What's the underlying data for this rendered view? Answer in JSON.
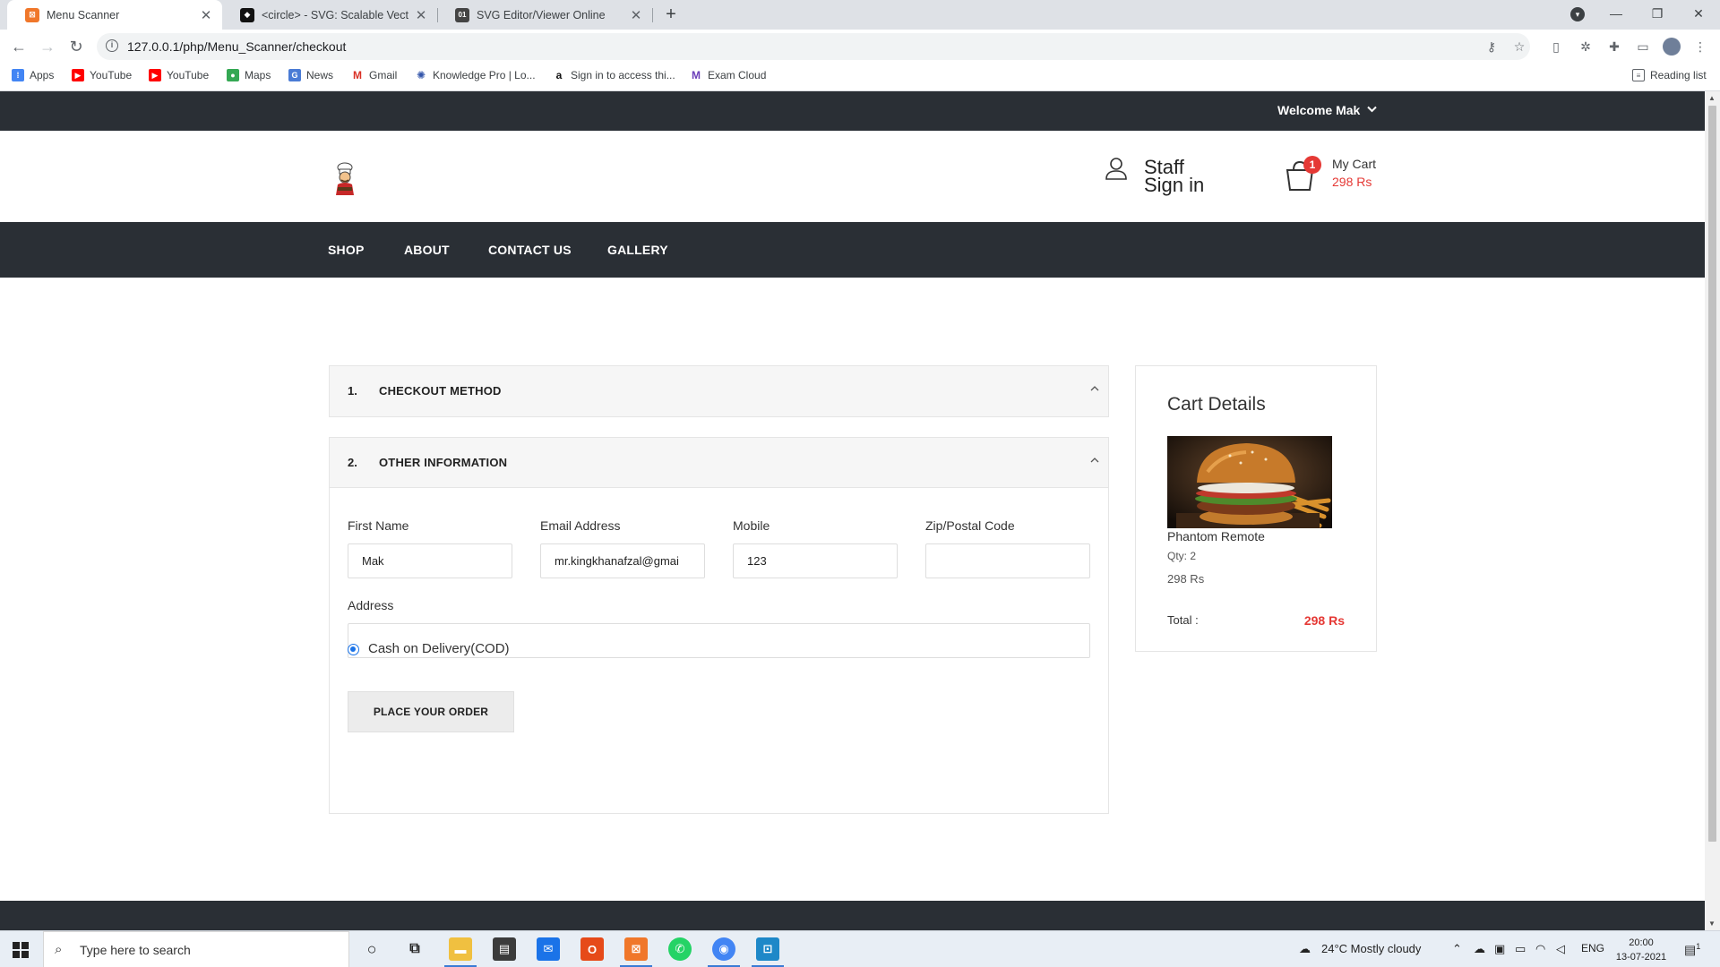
{
  "browser": {
    "tabs": [
      {
        "title": "Menu Scanner",
        "active": true
      },
      {
        "title": "<circle> - SVG: Scalable Vector G",
        "active": false
      },
      {
        "title": "SVG Editor/Viewer Online",
        "active": false
      }
    ],
    "url": "127.0.0.1/php/Menu_Scanner/checkout",
    "bookmarks": [
      "Apps",
      "YouTube",
      "YouTube",
      "Maps",
      "News",
      "Gmail",
      "Knowledge Pro | Lo...",
      "Sign in to access thi...",
      "Exam Cloud"
    ],
    "reading_list": "Reading list"
  },
  "site": {
    "welcome": "Welcome Mak",
    "staff_line1": "Staff",
    "staff_line2": "Sign in",
    "cart_count": "1",
    "cart_label": "My Cart",
    "cart_amount": "298 Rs",
    "nav": [
      "SHOP",
      "ABOUT",
      "CONTACT US",
      "GALLERY"
    ]
  },
  "checkout": {
    "step1": {
      "num": "1.",
      "label": "CHECKOUT METHOD"
    },
    "step2": {
      "num": "2.",
      "label": "OTHER INFORMATION"
    },
    "fields": {
      "first_name": {
        "label": "First Name",
        "value": "Mak"
      },
      "email": {
        "label": "Email Address",
        "value": "mr.kingkhanafzal@gmai"
      },
      "mobile": {
        "label": "Mobile",
        "value": "123"
      },
      "zip": {
        "label": "Zip/Postal Code",
        "value": ""
      },
      "address": {
        "label": "Address",
        "value": ""
      }
    },
    "payment_option": "Cash on Delivery(COD)",
    "place_order": "PLACE YOUR ORDER"
  },
  "cart_details": {
    "title": "Cart Details",
    "item_name": "Phantom Remote",
    "qty": "Qty: 2",
    "price": "298 Rs",
    "total_label": "Total :",
    "total_value": "298 Rs"
  },
  "taskbar": {
    "search_placeholder": "Type here to search",
    "weather": "24°C  Mostly cloudy",
    "lang": "ENG",
    "time": "20:00",
    "date": "13-07-2021",
    "notifications": "1"
  },
  "colors": {
    "dark": "#2a2f35",
    "accent_red": "#e53935",
    "radio_blue": "#1a73e8"
  }
}
